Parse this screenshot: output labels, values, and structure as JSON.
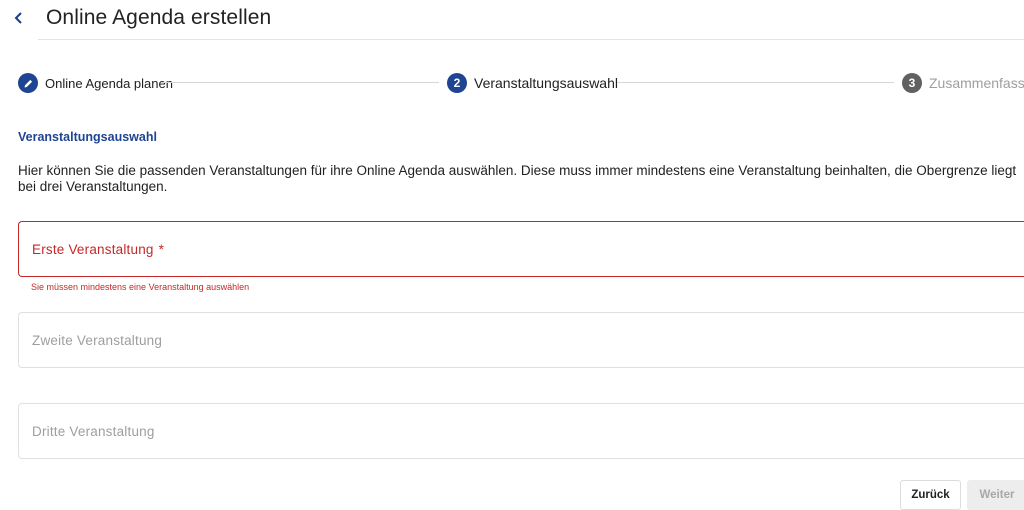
{
  "header": {
    "title": "Online Agenda erstellen"
  },
  "stepper": {
    "steps": [
      {
        "number": "",
        "label": "Online Agenda planen",
        "state": "completed"
      },
      {
        "number": "2",
        "label": "Veranstaltungsauswahl",
        "state": "active"
      },
      {
        "number": "3",
        "label": "Zusammenfassung",
        "state": "inactive"
      }
    ]
  },
  "section": {
    "title": "Veranstaltungsauswahl",
    "description": "Hier können Sie die passenden Veranstaltungen für ihre Online Agenda auswählen. Diese muss immer mindestens eine Veranstaltung beinhalten, die Obergrenze liegt bei drei Veranstaltungen."
  },
  "fields": [
    {
      "label": "Erste Veranstaltung",
      "required_mark": "*",
      "error": "Sie müssen mindestens eine Veranstaltung auswählen"
    },
    {
      "label": "Zweite Veranstaltung"
    },
    {
      "label": "Dritte Veranstaltung"
    }
  ],
  "actions": {
    "back_label": "Zurück",
    "next_label": "Weiter"
  },
  "colors": {
    "primary": "#1f4592",
    "error": "#c62828",
    "inactive_step": "#616161",
    "disabled_button_bg": "#ededed"
  },
  "icons": {
    "back": "chevron-left-icon",
    "completed_step": "pencil-icon"
  }
}
